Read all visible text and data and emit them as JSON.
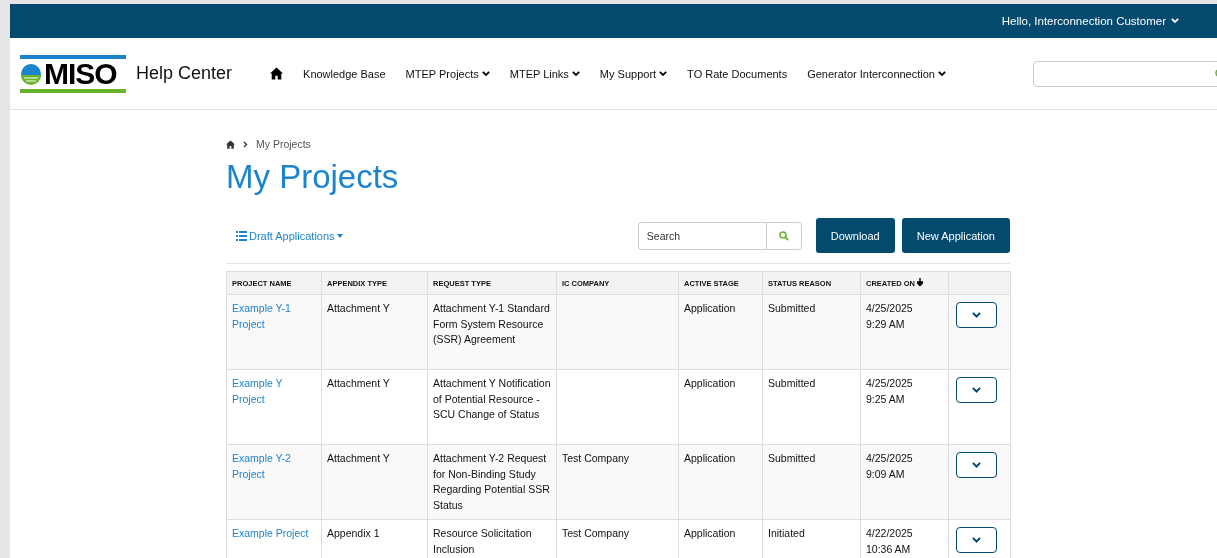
{
  "top_bar": {
    "user_menu": {
      "label": "Hello, Interconnection Customer",
      "has_dropdown": true
    }
  },
  "header": {
    "logo_text": "MISO",
    "site_title": "Help Center",
    "nav": [
      {
        "kind": "home"
      },
      {
        "kind": "link",
        "label": "Knowledge Base",
        "has_dropdown": false
      },
      {
        "kind": "link",
        "label": "MTEP Projects",
        "has_dropdown": true
      },
      {
        "kind": "link",
        "label": "MTEP Links",
        "has_dropdown": true
      },
      {
        "kind": "link",
        "label": "My Support",
        "has_dropdown": true
      },
      {
        "kind": "link",
        "label": "TO Rate Documents",
        "has_dropdown": false
      },
      {
        "kind": "link",
        "label": "Generator Interconnection",
        "has_dropdown": true
      }
    ]
  },
  "breadcrumb": [
    {
      "kind": "home"
    },
    {
      "kind": "text",
      "label": "My Projects"
    }
  ],
  "page_title": "My Projects",
  "toolbar": {
    "view_menu": "Draft Applications",
    "search": {
      "placeholder": "Search"
    },
    "buttons": [
      "Download",
      "New Application"
    ]
  },
  "table": {
    "columns": [
      {
        "label": "PROJECT NAME",
        "sorted": false
      },
      {
        "label": "APPENDIX TYPE",
        "sorted": false
      },
      {
        "label": "REQUEST TYPE",
        "sorted": false
      },
      {
        "label": "IC COMPANY",
        "sorted": false
      },
      {
        "label": "ACTIVE STAGE",
        "sorted": false
      },
      {
        "label": "STATUS REASON",
        "sorted": false
      },
      {
        "label": "CREATED ON",
        "sorted": true
      },
      {
        "sorted": false
      }
    ],
    "rows": [
      {
        "project_name": "Example Y-1 Project",
        "appendix_type": "Attachment Y",
        "request_type": "Attachment Y-1 Standard Form System Resource (SSR) Agreement",
        "ic_company": "",
        "active_stage": "Application",
        "status_reason": "Submitted",
        "created_on": "4/25/2025 9:29 AM"
      },
      {
        "project_name": "Example Y Project",
        "appendix_type": "Attachment Y",
        "request_type": "Attachment Y Notification of Potential Resource - SCU Change of Status",
        "ic_company": "",
        "active_stage": "Application",
        "status_reason": "Submitted",
        "created_on": "4/25/2025 9:25 AM"
      },
      {
        "project_name": "Example Y-2 Project",
        "appendix_type": "Attachment Y",
        "request_type": "Attachment Y-2 Request for Non-Binding Study Regarding Potential SSR Status",
        "ic_company": "Test Company",
        "active_stage": "Application",
        "status_reason": "Submitted",
        "created_on": "4/25/2025 9:09 AM"
      },
      {
        "project_name": "Example Project",
        "appendix_type": "Appendix 1",
        "request_type": "Resource Solicitation Inclusion",
        "ic_company": "Test Company",
        "active_stage": "Application",
        "status_reason": "Initiated",
        "created_on": "4/22/2025 10:36 AM"
      }
    ]
  }
}
